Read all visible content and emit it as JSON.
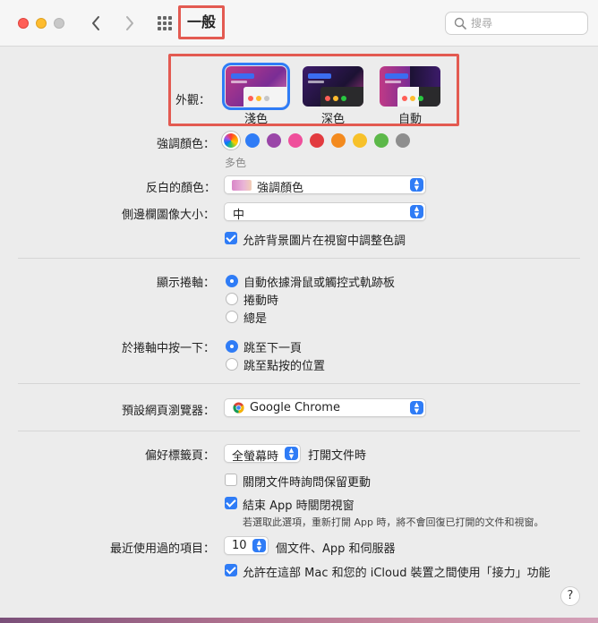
{
  "window": {
    "title": "一般",
    "search_placeholder": "搜尋"
  },
  "appearance": {
    "label": "外觀：",
    "options": [
      {
        "name": "淺色",
        "selected": true
      },
      {
        "name": "深色",
        "selected": false
      },
      {
        "name": "自動",
        "selected": false
      }
    ]
  },
  "accent": {
    "label": "強調顏色：",
    "selected_name": "多色",
    "colors": [
      "multicolor",
      "#2f7cf6",
      "#9a46a8",
      "#ef4f9b",
      "#e23b3f",
      "#f38a1e",
      "#f7c12a",
      "#5cb849",
      "#8e8e8e"
    ]
  },
  "highlight": {
    "label": "反白的顏色：",
    "value": "強調顏色"
  },
  "sidebar_icon_size": {
    "label": "側邊欄圖像大小：",
    "value": "中"
  },
  "wallpaper_tinting": {
    "label": "允許背景圖片在視窗中調整色調",
    "checked": true
  },
  "show_scrollbars": {
    "label": "顯示捲軸：",
    "options": [
      {
        "label": "自動依據滑鼠或觸控式軌跡板",
        "selected": true
      },
      {
        "label": "捲動時",
        "selected": false
      },
      {
        "label": "總是",
        "selected": false
      }
    ]
  },
  "click_scrollbar": {
    "label": "於捲軸中按一下：",
    "options": [
      {
        "label": "跳至下一頁",
        "selected": true
      },
      {
        "label": "跳至點按的位置",
        "selected": false
      }
    ]
  },
  "default_browser": {
    "label": "預設網頁瀏覽器：",
    "value": "Google Chrome"
  },
  "prefer_tabs": {
    "label": "偏好標籤頁：",
    "value": "全螢幕時",
    "suffix": "打開文件時"
  },
  "ask_keep_changes": {
    "label": "關閉文件時詢問保留更動",
    "checked": false
  },
  "close_windows": {
    "label": "結束 App 時關閉視窗",
    "checked": true,
    "note": "若選取此選項，重新打開 App 時，將不會回復已打開的文件和視窗。"
  },
  "recent_items": {
    "label": "最近使用過的項目：",
    "value": "10",
    "suffix": "個文件、App 和伺服器"
  },
  "handoff": {
    "label": "允許在這部 Mac 和您的 iCloud 裝置之間使用「接力」功能",
    "checked": true
  },
  "help": {
    "label": "?"
  }
}
